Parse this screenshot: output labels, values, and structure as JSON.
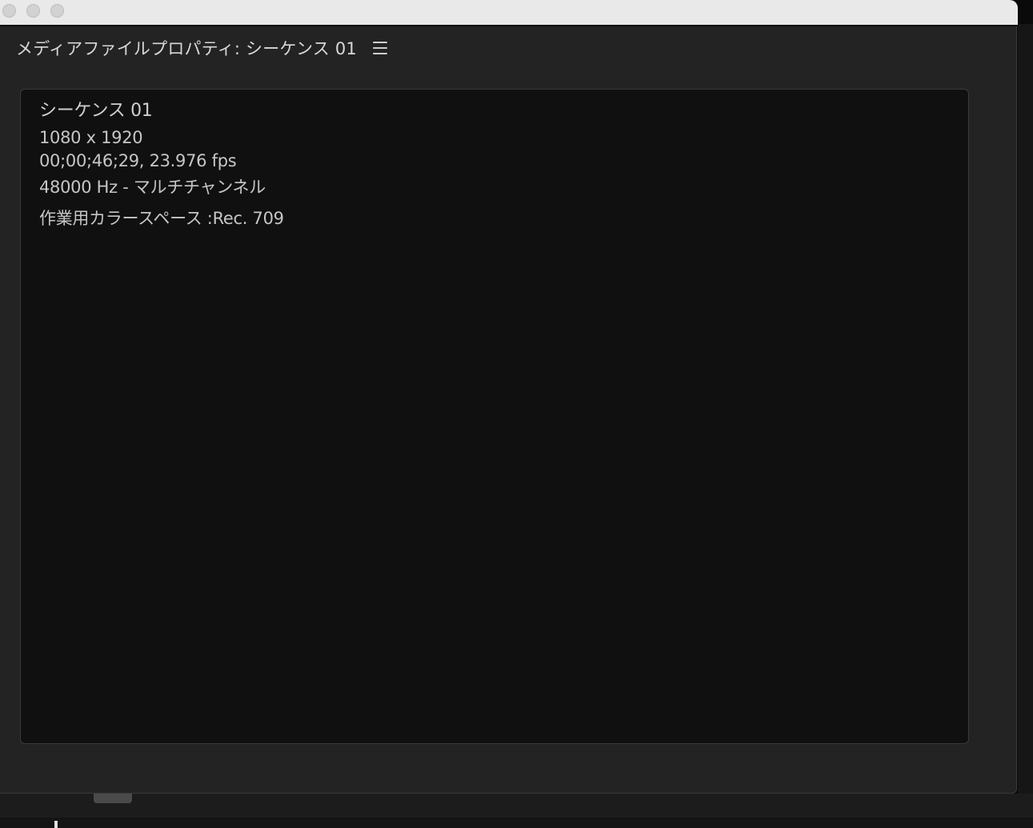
{
  "window": {
    "controls": [
      "close-icon",
      "minimize-icon",
      "zoom-icon"
    ]
  },
  "panel": {
    "title": "メディアファイルプロパティ: シーケンス 01",
    "menu_icon": "hamburger-menu-icon"
  },
  "properties": {
    "name": "シーケンス 01",
    "resolution": "1080 x 1920",
    "duration_fps": "00;00;46;29, 23.976 fps",
    "audio": "48000 Hz - マルチチャンネル",
    "color_space": "作業用カラースペース :Rec. 709"
  }
}
